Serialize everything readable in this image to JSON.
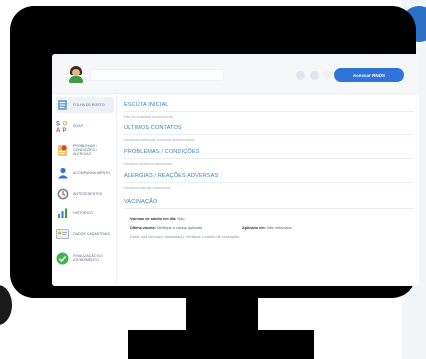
{
  "app": {
    "primary_button": "Acessar RNDS",
    "colors": {
      "accent": "#2f74d9",
      "section_title": "#3a82c8",
      "monitor": "#000000"
    }
  },
  "sidebar": {
    "items": [
      {
        "label": "FOLHA DE ROSTO",
        "icon": "clipboard-icon"
      },
      {
        "label": "SOAP",
        "icon": "soap-icon"
      },
      {
        "label": "PROBLEMAS / CONDIÇÕES / ALERGIAS",
        "icon": "notes-icon"
      },
      {
        "label": "ACOMPANHA-MENTO",
        "icon": "person-icon"
      },
      {
        "label": "ANTECEDENTES",
        "icon": "history-icon"
      },
      {
        "label": "HISTÓRICO",
        "icon": "chart-icon"
      },
      {
        "label": "DADOS CADASTRAIS",
        "icon": "id-card-icon"
      },
      {
        "label": "FINALIZAÇÃO DO ATENDIMENTO",
        "icon": "check-icon"
      }
    ]
  },
  "main": {
    "sections": [
      {
        "title": "ESCUTA INICIAL",
        "text": "Não foi realizada escuta inicial."
      },
      {
        "title": "ÚLTIMOS CONTATOS",
        "text": "Nenhuma avaliação realizada anteriormente."
      },
      {
        "title": "PROBLEMAS / CONDIÇÕES",
        "text": "Nenhum problema cadastrado."
      },
      {
        "title": "ALERGIAS / REAÇÕES ADVERSAS",
        "text": "Nenhuma alergia cadastrada."
      }
    ],
    "vaccination": {
      "title": "VACINAÇÃO",
      "pregnancy_label": "Vacinas de adulto em dia:",
      "pregnancy_value": "Não",
      "last_label": "Última vacina:",
      "last_value": "Verifique a vacina aplicada",
      "applied_label": "Aplicado em:",
      "applied_value": "Não informado",
      "note": "Exibir o(s) vacina(s) atrasada(s). Verifique o cartão de vacinação."
    }
  }
}
